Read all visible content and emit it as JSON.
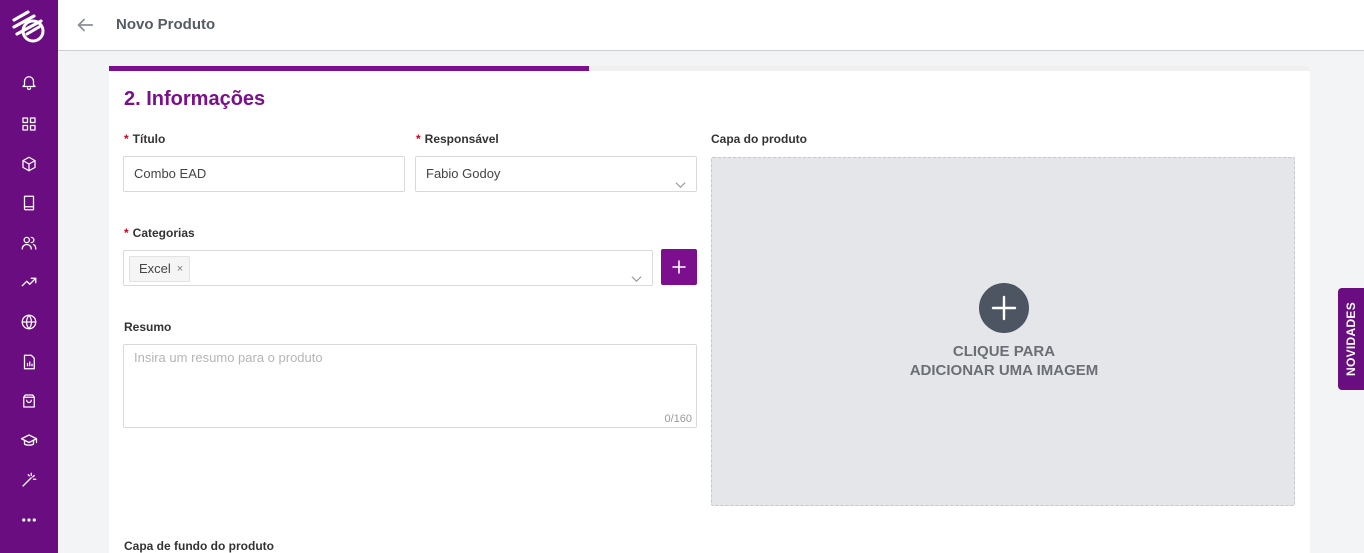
{
  "header": {
    "title": "Novo Produto"
  },
  "sidebar": {
    "items": [
      {
        "icon": "bell-icon"
      },
      {
        "icon": "dashboard-icon"
      },
      {
        "icon": "box-icon"
      },
      {
        "icon": "book-icon"
      },
      {
        "icon": "users-icon"
      },
      {
        "icon": "trending-up-icon"
      },
      {
        "icon": "globe-icon"
      },
      {
        "icon": "report-icon"
      },
      {
        "icon": "shopping-bag-icon"
      },
      {
        "icon": "graduation-cap-icon"
      },
      {
        "icon": "magic-wand-icon"
      },
      {
        "icon": "more-icon"
      }
    ]
  },
  "form": {
    "progress_percent": 40,
    "section_title": "2. Informações",
    "required_mark": "*",
    "title_label": "Título",
    "title_value": "Combo EAD",
    "responsible_label": "Responsável",
    "responsible_value": "Fabio Godoy",
    "categories_label": "Categorias",
    "categories": [
      "Excel"
    ],
    "tag_remove": "×",
    "summary_label": "Resumo",
    "summary_placeholder": "Insira um resumo para o produto",
    "summary_counter": "0/160",
    "cover_label": "Capa do produto",
    "cover_cta_line1": "CLIQUE PARA",
    "cover_cta_line2": "ADICIONAR UMA IMAGEM",
    "background_cover_label": "Capa de fundo do produto"
  },
  "novidades": {
    "label": "NOVIDADES"
  },
  "colors": {
    "brand": "#6a0d80",
    "accent": "#7b0f8e",
    "required": "#d0021b"
  }
}
